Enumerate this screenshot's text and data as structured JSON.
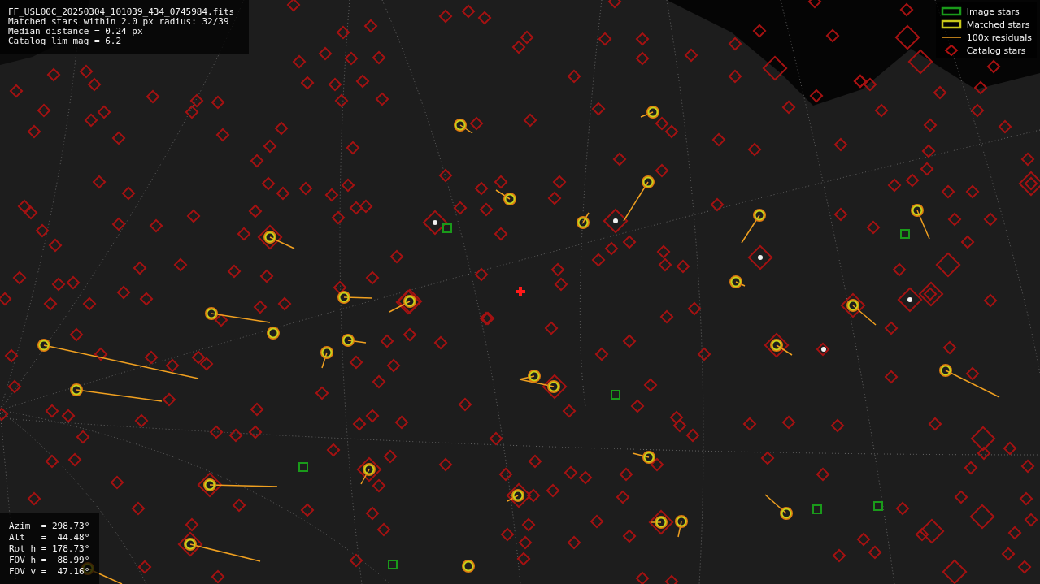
{
  "file_info": {
    "lines": [
      "FF_USL00C_20250304_101039_434_0745984.fits",
      "Matched stars within 2.0 px radius: 32/39",
      "Median distance = 0.24 px",
      "Catalog lim mag = 6.2"
    ]
  },
  "legend": [
    {
      "kind": "image",
      "label": "Image stars"
    },
    {
      "kind": "matched",
      "label": "Matched stars"
    },
    {
      "kind": "residual",
      "label": "100x residuals"
    },
    {
      "kind": "catalog",
      "label": "Catalog stars"
    }
  ],
  "pointing": {
    "lines": [
      "Azim  = 298.73°",
      "Alt   =  44.48°",
      "Rot h = 178.73°",
      "FOV h =  88.99°",
      "FOV v =  47.16°"
    ]
  }
}
